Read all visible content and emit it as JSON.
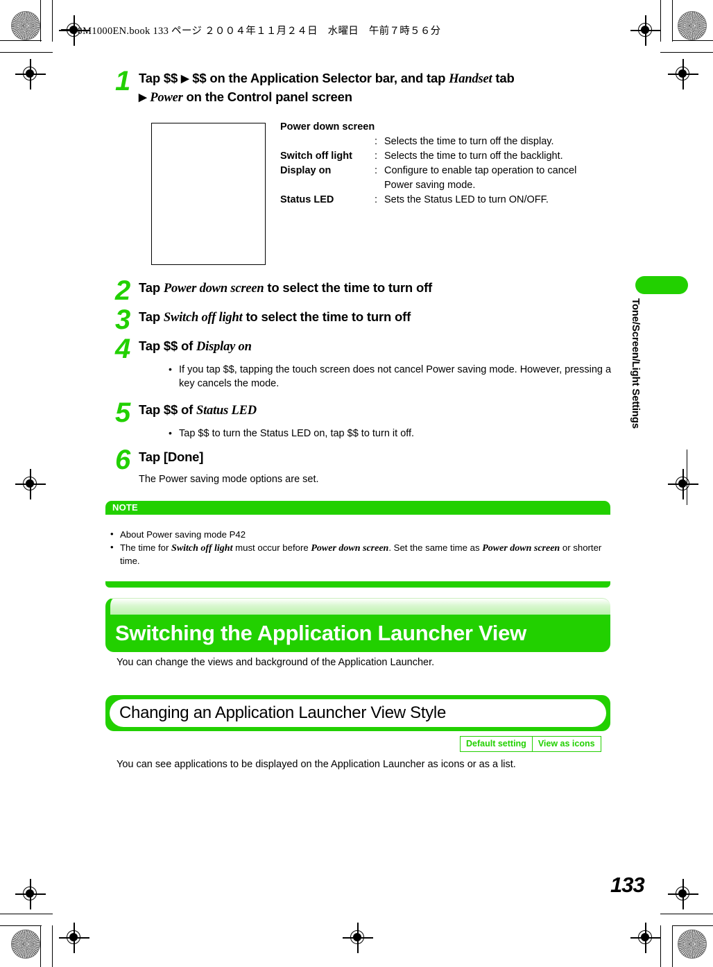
{
  "print_header": {
    "text": "00M1000EN.book  133 ページ  ２００４年１１月２４日　水曜日　午前７時５６分"
  },
  "steps": [
    {
      "number": "1",
      "title_parts": [
        {
          "t": "Tap $$ ",
          "style": "bold"
        },
        {
          "t": "▶",
          "style": "arrow"
        },
        {
          "t": " $$ on the Application Selector bar, and tap ",
          "style": "bold"
        },
        {
          "t": "Handset",
          "style": "italic"
        },
        {
          "t": " tab",
          "style": "bold"
        }
      ],
      "title_line2_parts": [
        {
          "t": "▶",
          "style": "arrow"
        },
        {
          "t": " ",
          "style": "bold"
        },
        {
          "t": "Power",
          "style": "italic"
        },
        {
          "t": " on the Control panel screen",
          "style": "bold"
        }
      ]
    },
    {
      "number": "2",
      "title_parts": [
        {
          "t": "Tap ",
          "style": "bold"
        },
        {
          "t": "Power down screen",
          "style": "italic"
        },
        {
          "t": " to select the time to turn off",
          "style": "bold"
        }
      ]
    },
    {
      "number": "3",
      "title_parts": [
        {
          "t": "Tap ",
          "style": "bold"
        },
        {
          "t": "Switch off light",
          "style": "italic"
        },
        {
          "t": " to select the time to turn off",
          "style": "bold"
        }
      ]
    },
    {
      "number": "4",
      "title_parts": [
        {
          "t": "Tap $$ of ",
          "style": "bold"
        },
        {
          "t": "Display on",
          "style": "italic"
        }
      ],
      "bullets": [
        "If you tap $$, tapping the touch screen does not cancel Power saving mode. However, pressing a key cancels the mode."
      ]
    },
    {
      "number": "5",
      "title_parts": [
        {
          "t": "Tap $$ of ",
          "style": "bold"
        },
        {
          "t": "Status LED",
          "style": "italic"
        }
      ],
      "bullets": [
        "Tap $$ to turn the Status LED on, tap $$ to turn it off."
      ]
    },
    {
      "number": "6",
      "title_parts": [
        {
          "t": "Tap [Done]",
          "style": "bold"
        }
      ],
      "plain": "The Power saving mode options are set."
    }
  ],
  "definitions": {
    "heading": "Power down screen",
    "rows": [
      {
        "term": "",
        "colon": ":",
        "desc": "Selects the time to turn off the display.",
        "desc2": ""
      },
      {
        "term": "Switch off light",
        "colon": ":",
        "desc": "Selects the time to turn off the backlight.",
        "desc2": ""
      },
      {
        "term": "Display on",
        "colon": ":",
        "desc": "Configure to enable tap operation to cancel",
        "desc2": "Power saving mode."
      },
      {
        "term": "Status LED",
        "colon": ":",
        "desc": "Sets the Status LED to turn ON/OFF.",
        "desc2": ""
      }
    ]
  },
  "note": {
    "label": "NOTE",
    "items": [
      {
        "parts": [
          {
            "t": "About Power saving mode P42",
            "style": "plain"
          }
        ]
      },
      {
        "parts": [
          {
            "t": "The time for ",
            "style": "plain"
          },
          {
            "t": "Switch off light",
            "style": "italic"
          },
          {
            "t": " must occur before ",
            "style": "plain"
          },
          {
            "t": "Power down screen",
            "style": "italic"
          },
          {
            "t": ". Set the same time as ",
            "style": "plain"
          },
          {
            "t": "Power down screen",
            "style": "italic"
          },
          {
            "t": " or shorter time.",
            "style": "plain"
          }
        ]
      }
    ]
  },
  "section": {
    "h1_title": "Switching the Application Launcher View",
    "h1_sub": "You can change the views and background of the Application Launcher.",
    "h2_title": "Changing an Application Launcher View Style",
    "h2_sub": "You can see applications to be displayed on the Application Launcher as icons or as a list."
  },
  "default_setting_table": {
    "label": "Default setting",
    "value": "View as icons"
  },
  "side_tab": {
    "label": "Tone/Screen/Light Settings"
  },
  "page_number": "133",
  "colors": {
    "accent_green": "#22d000",
    "header_text": "#ffffff"
  }
}
